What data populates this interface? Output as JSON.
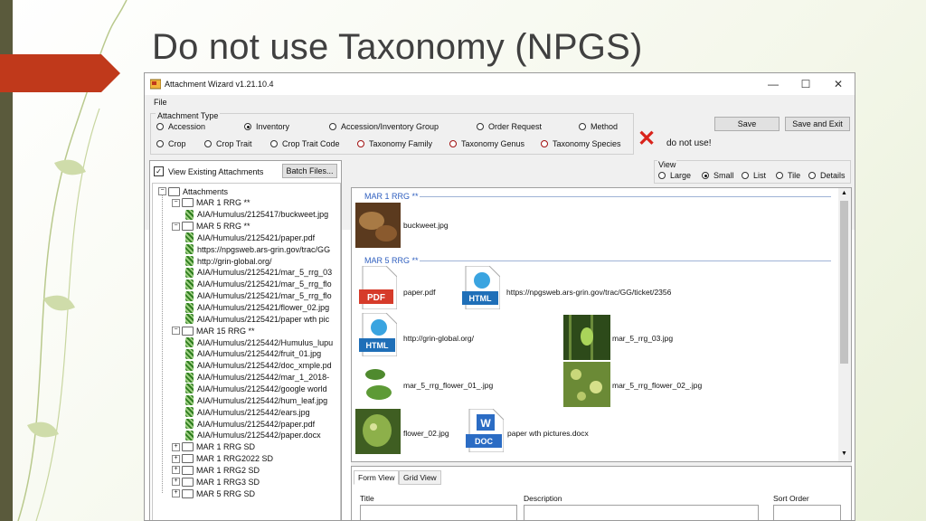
{
  "slide": {
    "title": "Do not use Taxonomy (NPGS)"
  },
  "window": {
    "title": "Attachment Wizard v1.21.10.4",
    "minimize": "—",
    "maximize": "☐",
    "close": "✕"
  },
  "menu": {
    "file": "File"
  },
  "attachment_type": {
    "label": "Attachment Type",
    "options": [
      {
        "label": "Accession",
        "selected": false
      },
      {
        "label": "Inventory",
        "selected": true
      },
      {
        "label": "Accession/Inventory Group",
        "selected": false
      },
      {
        "label": "Order Request",
        "selected": false
      },
      {
        "label": "Method",
        "selected": false
      },
      {
        "label": "Crop",
        "selected": false
      },
      {
        "label": "Crop Trait",
        "selected": false
      },
      {
        "label": "Crop Trait Code",
        "selected": false
      },
      {
        "label": "Taxonomy Family",
        "selected": false
      },
      {
        "label": "Taxonomy Genus",
        "selected": false
      },
      {
        "label": "Taxonomy Species",
        "selected": false
      }
    ]
  },
  "buttons": {
    "save": "Save",
    "save_exit": "Save and Exit",
    "batch_files": "Batch Files..."
  },
  "warning": {
    "text": "do not use!",
    "color": "#d9231b",
    "highlight": "#f08a8a"
  },
  "left": {
    "view_existing": "View Existing Attachments",
    "tree": [
      {
        "label": "Attachments",
        "kind": "folder"
      },
      {
        "label": "MAR 1 RRG **",
        "kind": "folder"
      },
      {
        "label": "AIA/Humulus/2125417/buckweet.jpg",
        "kind": "leaf"
      },
      {
        "label": "MAR 5 RRG **",
        "kind": "folder"
      },
      {
        "label": "AIA/Humulus/2125421/paper.pdf",
        "kind": "leaf"
      },
      {
        "label": "https://npgsweb.ars-grin.gov/trac/GG",
        "kind": "leaf"
      },
      {
        "label": "http://grin-global.org/",
        "kind": "leaf"
      },
      {
        "label": "AIA/Humulus/2125421/mar_5_rrg_03",
        "kind": "leaf"
      },
      {
        "label": "AIA/Humulus/2125421/mar_5_rrg_flo",
        "kind": "leaf"
      },
      {
        "label": "AIA/Humulus/2125421/mar_5_rrg_flo",
        "kind": "leaf"
      },
      {
        "label": "AIA/Humulus/2125421/flower_02.jpg",
        "kind": "leaf"
      },
      {
        "label": "AIA/Humulus/2125421/paper wth pic",
        "kind": "leaf"
      },
      {
        "label": "MAR 15 RRG **",
        "kind": "folder"
      },
      {
        "label": "AIA/Humulus/2125442/Humulus_lupu",
        "kind": "leaf"
      },
      {
        "label": "AIA/Humulus/2125442/fruit_01.jpg",
        "kind": "leaf"
      },
      {
        "label": "AIA/Humulus/2125442/doc_xmple.pd",
        "kind": "leaf"
      },
      {
        "label": "AIA/Humulus/2125442/mar_1_2018-",
        "kind": "leaf"
      },
      {
        "label": "AIA/Humulus/2125442/google world",
        "kind": "leaf"
      },
      {
        "label": "AIA/Humulus/2125442/hum_leaf.jpg",
        "kind": "leaf"
      },
      {
        "label": "AIA/Humulus/2125442/ears.jpg",
        "kind": "leaf"
      },
      {
        "label": "AIA/Humulus/2125442/paper.pdf",
        "kind": "leaf"
      },
      {
        "label": "AIA/Humulus/2125442/paper.docx",
        "kind": "leaf"
      },
      {
        "label": "MAR 1 RRG SD",
        "kind": "folder"
      },
      {
        "label": "MAR 1 RRG2022 SD",
        "kind": "folder"
      },
      {
        "label": "MAR 1 RRG2 SD",
        "kind": "folder"
      },
      {
        "label": "MAR 1 RRG3 SD",
        "kind": "folder"
      },
      {
        "label": "MAR 5 RRG SD",
        "kind": "folder"
      }
    ]
  },
  "view": {
    "label": "View",
    "options": [
      {
        "label": "Large",
        "selected": false
      },
      {
        "label": "Small",
        "selected": true
      },
      {
        "label": "List",
        "selected": false
      },
      {
        "label": "Tile",
        "selected": false
      },
      {
        "label": "Details",
        "selected": false
      }
    ]
  },
  "gallery": {
    "sections": [
      "MAR 1 RRG **",
      "MAR 5 RRG **"
    ],
    "items": [
      {
        "name": "buckweet.jpg",
        "icon": "photo-icon"
      },
      {
        "name": "paper.pdf",
        "icon": "pdf-icon",
        "badge": "PDF"
      },
      {
        "name": "https://npgsweb.ars-grin.gov/trac/GG/ticket/2356",
        "icon": "html-icon",
        "badge": "HTML"
      },
      {
        "name": "http://grin-global.org/",
        "icon": "html-icon",
        "badge": "HTML"
      },
      {
        "name": "mar_5_rrg_03.jpg",
        "icon": "photo-icon"
      },
      {
        "name": "mar_5_rrg_flower_01_.jpg",
        "icon": "photo-icon"
      },
      {
        "name": "mar_5_rrg_flower_02_.jpg",
        "icon": "photo-icon"
      },
      {
        "name": "flower_02.jpg",
        "icon": "photo-icon"
      },
      {
        "name": "paper wth pictures.docx",
        "icon": "doc-icon",
        "badge": "DOC",
        "letter": "W"
      }
    ]
  },
  "form": {
    "tabs": [
      "Form View",
      "Grid View"
    ],
    "fields": [
      "Title",
      "Description",
      "Sort Order"
    ]
  }
}
